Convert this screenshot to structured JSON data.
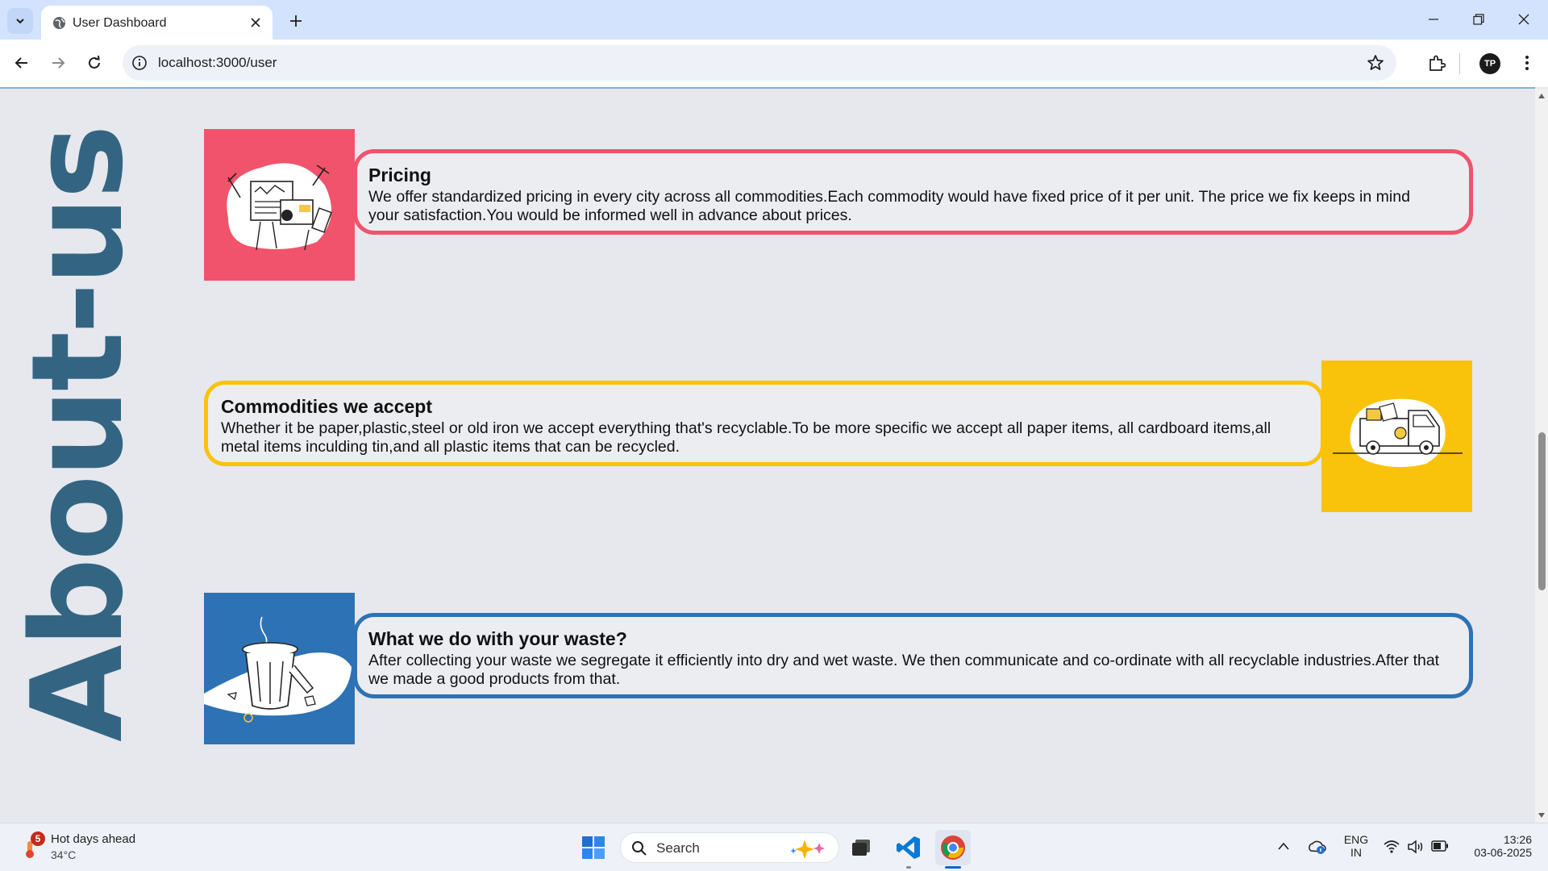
{
  "browser": {
    "tab_title": "User Dashboard",
    "url": "localhost:3000/user",
    "avatar_initials": "TP"
  },
  "page": {
    "side_title": "About-us",
    "cards": [
      {
        "heading": "Pricing",
        "text": "We offer standardized pricing in every city across all commodities.Each commodity would have fixed price of it per unit. The price we fix keeps in mind your satisfaction.You would be informed well in advance about prices.",
        "color": "#f0536b",
        "image_icon": "pricing-illustration"
      },
      {
        "heading": "Commodities we accept",
        "text": "Whether it be paper,plastic,steel or old iron we accept everything that's recyclable.To be more specific we accept all paper items, all cardboard items,all metal items inculding tin,and all plastic items that can be recycled.",
        "color": "#fac30b",
        "image_icon": "truck-illustration"
      },
      {
        "heading": "What we do with your waste?",
        "text": "After collecting your waste we segregate it efficiently into dry and wet waste. We then communicate and co-ordinate with all recyclable industries.After that we made a good products from that.",
        "color": "#2d72b4",
        "image_icon": "trash-can-illustration"
      }
    ]
  },
  "taskbar": {
    "weather_badge": "5",
    "weather_title": "Hot days ahead",
    "weather_temp": "34°C",
    "search_label": "Search",
    "lang_1": "ENG",
    "lang_2": "IN",
    "time": "13:26",
    "date": "03-06-2025"
  }
}
